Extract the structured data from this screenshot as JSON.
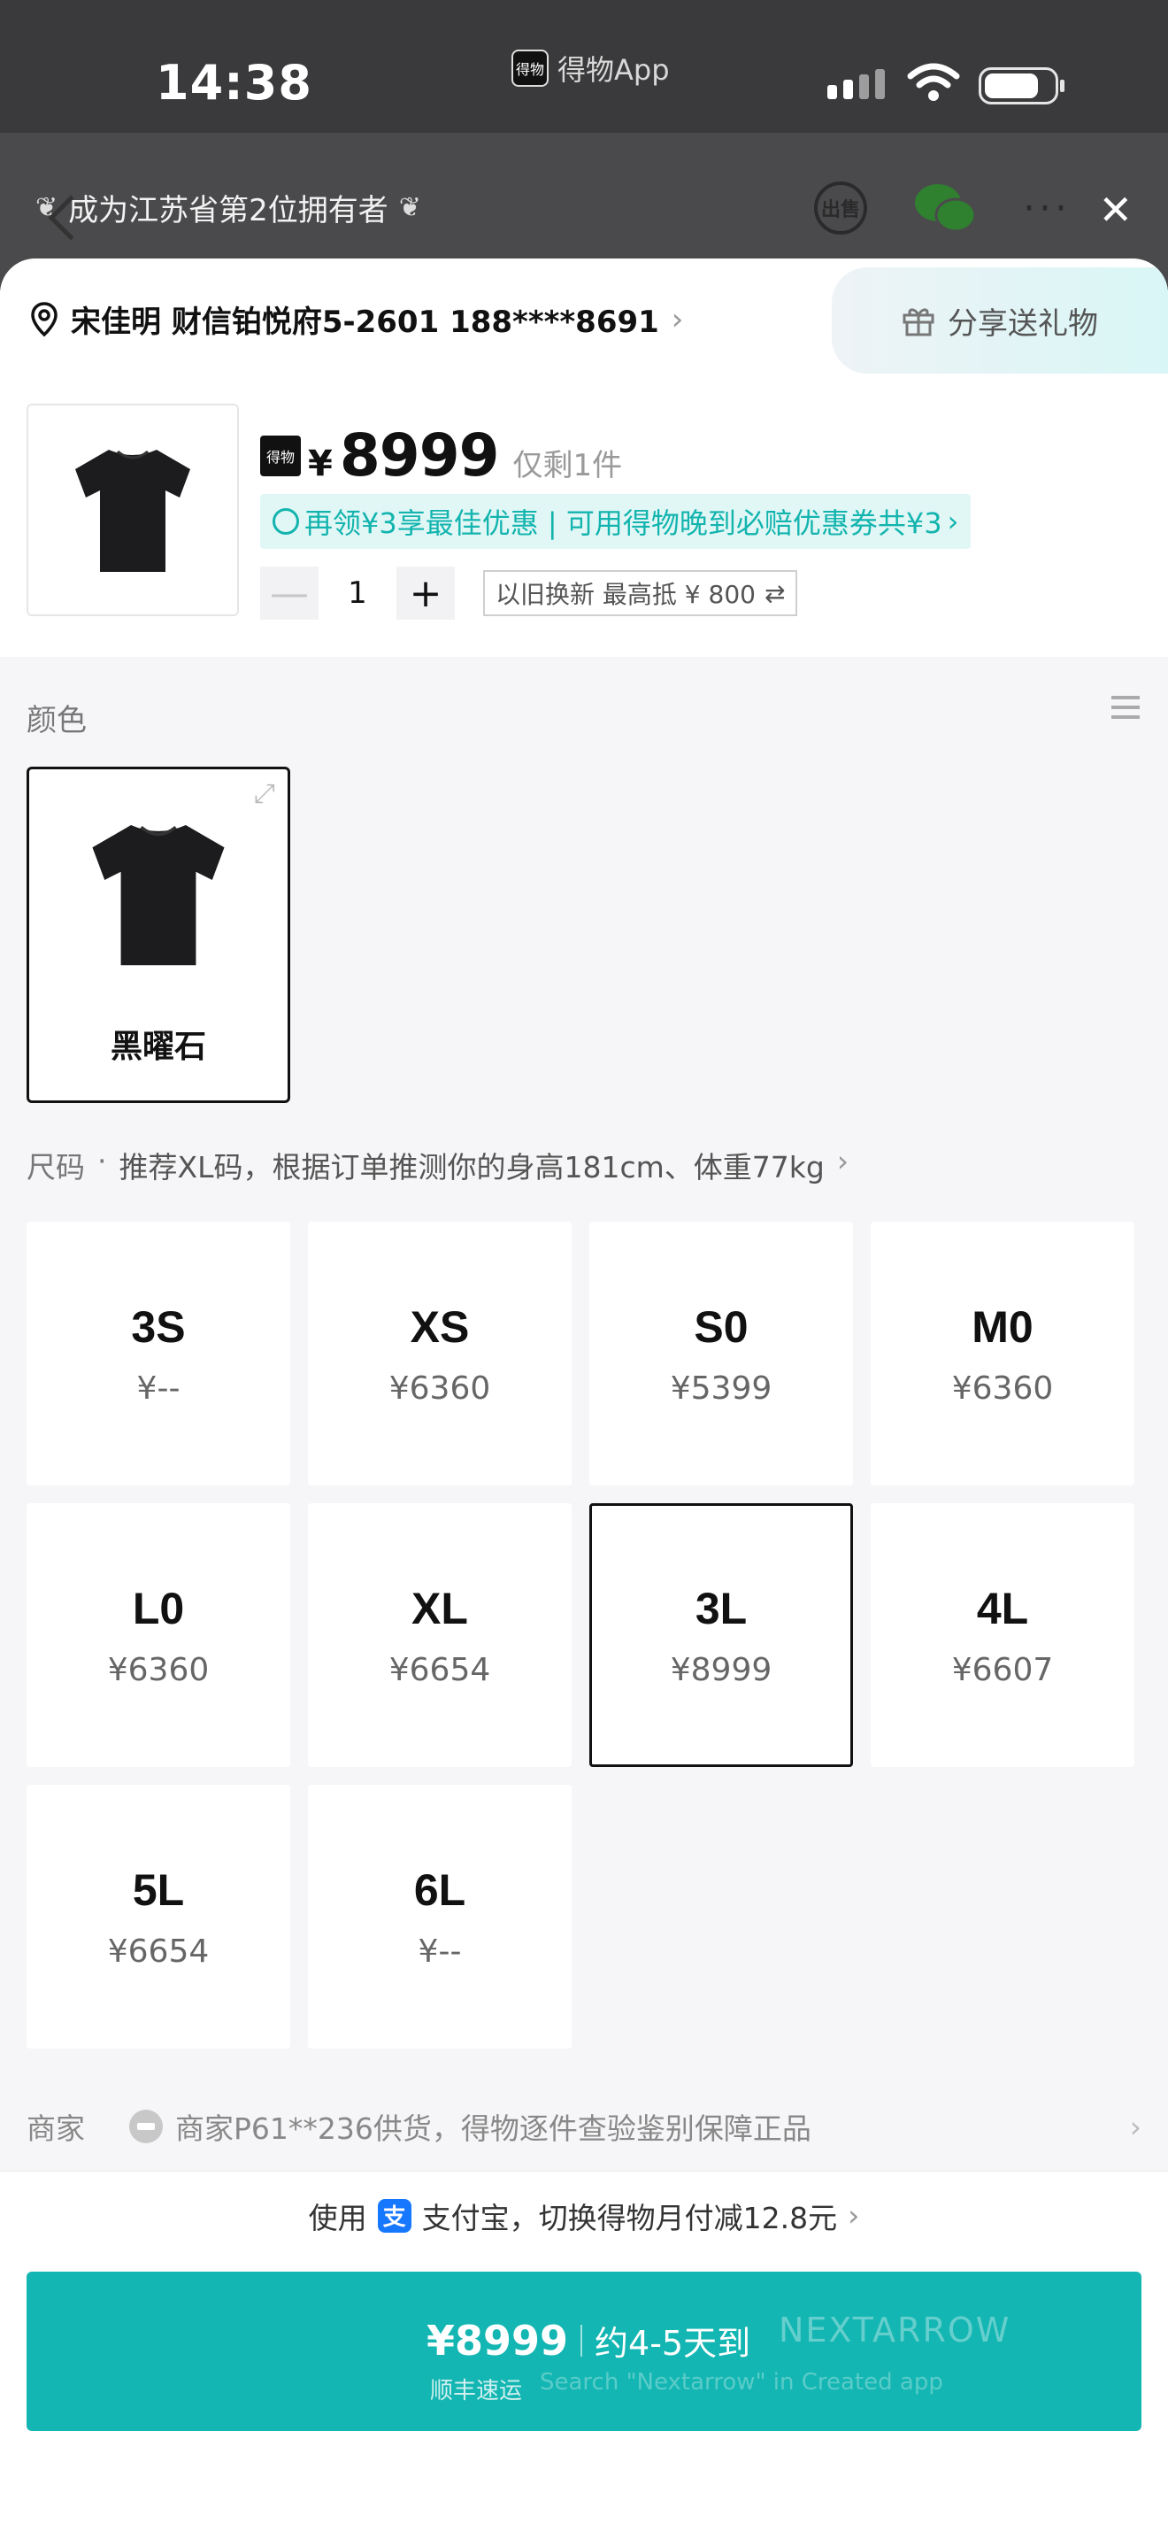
{
  "status_bar": {
    "time": "14:38",
    "app_badge": "得物",
    "app_name": "得物App"
  },
  "header": {
    "banner_text": "成为江苏省第2位拥有者",
    "sell_icon_text": "出售",
    "close": "✕",
    "icons": [
      "back-icon",
      "sell-icon",
      "wechat-icon",
      "more-icon",
      "close-icon"
    ]
  },
  "address": {
    "text": "宋佳明 财信铂悦府5-2601 188****8691",
    "arrow": "›",
    "share_label": "分享送礼物"
  },
  "product": {
    "logo_text": "得物",
    "currency": "¥",
    "price": "8999",
    "stock": "仅剩1件",
    "promo": "再领¥3享最佳优惠 | 可用得物晚到必赔优惠券共¥3",
    "promo_arrow": "›",
    "qty_minus": "—",
    "qty": "1",
    "qty_plus": "+",
    "tradein": "以旧换新  最高抵 ¥ 800",
    "tradein_icon": "⇄"
  },
  "color_section": {
    "label": "颜色",
    "options": [
      {
        "name": "黑曜石",
        "selected": true
      }
    ]
  },
  "size_section": {
    "label": "尺码",
    "dot": "·",
    "hint": "推荐XL码，根据订单推测你的身高181cm、体重77kg",
    "hint_arrow": "›",
    "sizes": [
      {
        "label": "3S",
        "price": "¥--"
      },
      {
        "label": "XS",
        "price": "¥6360"
      },
      {
        "label": "S0",
        "price": "¥5399"
      },
      {
        "label": "M0",
        "price": "¥6360"
      },
      {
        "label": "L0",
        "price": "¥6360"
      },
      {
        "label": "XL",
        "price": "¥6654"
      },
      {
        "label": "3L",
        "price": "¥8999",
        "selected": true
      },
      {
        "label": "4L",
        "price": "¥6607"
      },
      {
        "label": "5L",
        "price": "¥6654"
      },
      {
        "label": "6L",
        "price": "¥--"
      }
    ]
  },
  "merchant": {
    "label": "商家",
    "text": "商家P61**236供货，得物逐件查验鉴别保障正品",
    "arrow": "›"
  },
  "payment": {
    "prefix": "使用",
    "alipay_glyph": "支",
    "text": "支付宝，切换得物月付减12.8元",
    "arrow": "›"
  },
  "buy": {
    "price": "¥8999",
    "eta": "约4-5天到",
    "courier": "顺丰速运",
    "watermark": "NEXTARROW",
    "watermark_sub": "Search \"Nextarrow\" in Created app"
  },
  "colors": {
    "accent": "#13b6b2",
    "promo_bg": "#e1f7f6",
    "promo_text": "#13b4ae",
    "alipay": "#1677ff"
  }
}
